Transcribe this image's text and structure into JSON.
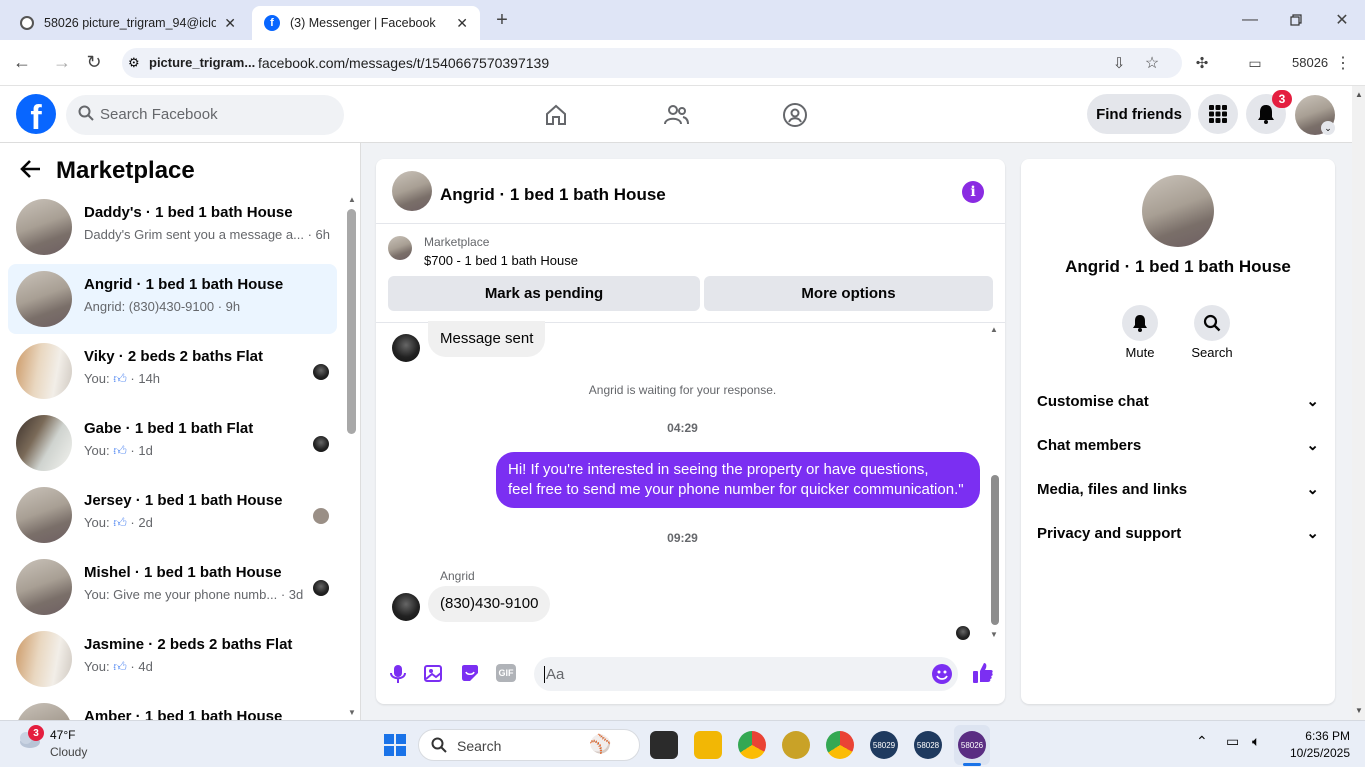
{
  "browser": {
    "tabs": [
      {
        "title": "58026 picture_trigram_94@iclo",
        "active": false
      },
      {
        "title": "(3) Messenger | Facebook",
        "active": true
      }
    ],
    "site_chip": "picture_trigram...",
    "url": "facebook.com/messages/t/1540667570397139",
    "profile_label": "58026"
  },
  "fb": {
    "search_placeholder": "Search Facebook",
    "find_friends": "Find friends",
    "notification_count": "3"
  },
  "left": {
    "title": "Marketplace",
    "conversations": [
      {
        "name": "Daddy's · 1 bed 1 bath House",
        "preview": "Daddy's Grim sent you a message a...",
        "time": "· 6h",
        "selected": false
      },
      {
        "name": "Angrid · 1 bed 1 bath House",
        "preview": "Angrid: (830)430-9100",
        "time": "· 9h",
        "selected": true
      },
      {
        "name": "Viky · 2 beds 2 baths Flat",
        "preview": "You:",
        "time": "· 14h",
        "like": true
      },
      {
        "name": "Gabe · 1 bed 1 bath Flat",
        "preview": "You:",
        "time": "· 1d",
        "like": true
      },
      {
        "name": "Jersey · 1 bed 1 bath House",
        "preview": "You:",
        "time": "· 2d",
        "like": true
      },
      {
        "name": "Mishel · 1 bed 1 bath House",
        "preview": "You: Give me your phone numb...",
        "time": "· 3d"
      },
      {
        "name": "Jasmine · 2 beds 2 baths Flat",
        "preview": "You:",
        "time": "· 4d",
        "like": true
      },
      {
        "name": "Amber · 1 bed 1 bath House",
        "preview": "",
        "time": ""
      }
    ]
  },
  "chat": {
    "header_name": "Angrid · 1 bed 1 bath House",
    "listing_source": "Marketplace",
    "listing_title": "$700 - 1 bed 1 bath House",
    "mark_pending": "Mark as pending",
    "more_options": "More options",
    "msg_sent": "Message sent",
    "waiting_text": "Angrid is waiting for your response.",
    "time1": "04:29",
    "outgoing": "Hi! If you're interested in seeing the property or have questions, feel free to send me your phone number for quicker communication.\"",
    "outgoing_line1": "Hi! If you're interested in seeing the property or have questions,",
    "outgoing_line2": "feel free to send me your phone number for quicker communication.\"",
    "time2": "09:29",
    "sender_name": "Angrid",
    "incoming": "(830)430-9100",
    "composer_placeholder": "Aa"
  },
  "info": {
    "name": "Angrid · 1 bed 1 bath House",
    "mute": "Mute",
    "search": "Search",
    "rows": [
      "Customise chat",
      "Chat members",
      "Media, files and links",
      "Privacy and support"
    ]
  },
  "taskbar": {
    "temp": "47°F",
    "weather": "Cloudy",
    "weather_badge": "3",
    "search": "Search",
    "time": "6:36 PM",
    "date": "10/25/2025",
    "app_labels": [
      "58029",
      "58028",
      "58026"
    ]
  },
  "colors": {
    "fb_blue": "#0866ff",
    "messenger_purple": "#7b2ff2",
    "selected_row": "#ebf5ff"
  }
}
